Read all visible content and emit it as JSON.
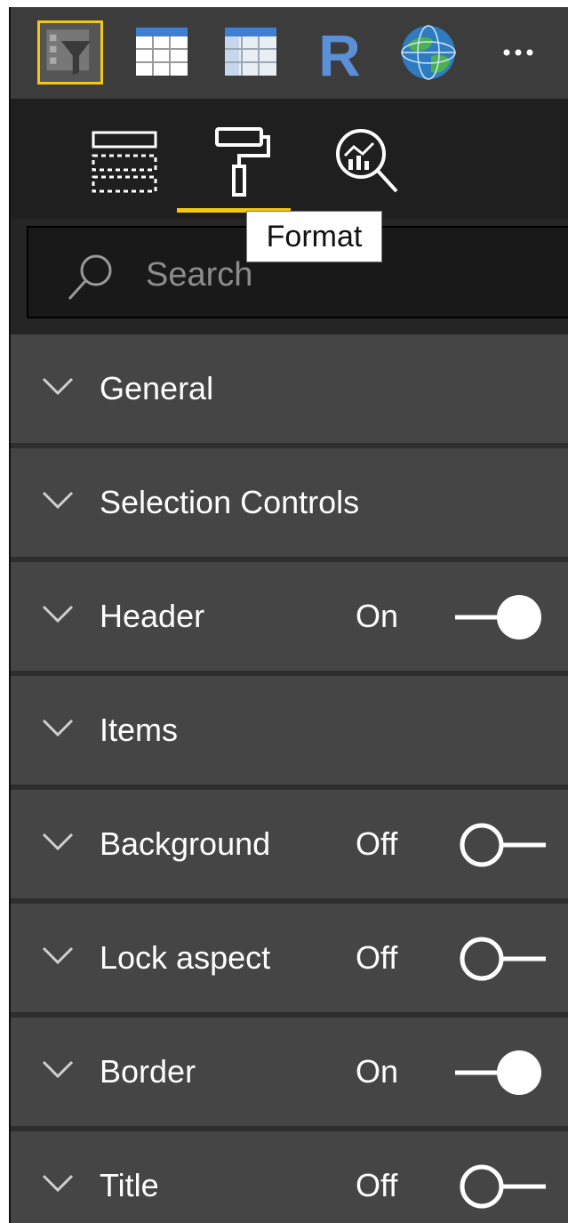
{
  "viz_icons": [
    {
      "name": "slicer-icon",
      "selected": true
    },
    {
      "name": "table-icon",
      "selected": false
    },
    {
      "name": "matrix-icon",
      "selected": false
    },
    {
      "name": "r-visual-icon",
      "label": "R"
    },
    {
      "name": "globe-map-icon",
      "selected": false
    },
    {
      "name": "more-options-icon",
      "label": "···"
    }
  ],
  "tabs": [
    {
      "name": "fields-tab",
      "icon": "fields-icon"
    },
    {
      "name": "format-tab",
      "icon": "paint-roller-icon",
      "active": true
    },
    {
      "name": "analytics-tab",
      "icon": "analytics-magnifier-icon"
    }
  ],
  "tooltip": "Format",
  "search": {
    "placeholder": "Search"
  },
  "sections": [
    {
      "label": "General"
    },
    {
      "label": "Selection Controls"
    },
    {
      "label": "Header",
      "state": "On",
      "on": true
    },
    {
      "label": "Items"
    },
    {
      "label": "Background",
      "state": "Off",
      "on": false
    },
    {
      "label": "Lock aspect",
      "state": "Off",
      "on": false
    },
    {
      "label": "Border",
      "state": "On",
      "on": true
    },
    {
      "label": "Title",
      "state": "Off",
      "on": false
    }
  ],
  "colors": {
    "accent": "#f2c811",
    "panel": "#454545",
    "text": "#ffffff",
    "r_blue": "#5b8fd6"
  }
}
